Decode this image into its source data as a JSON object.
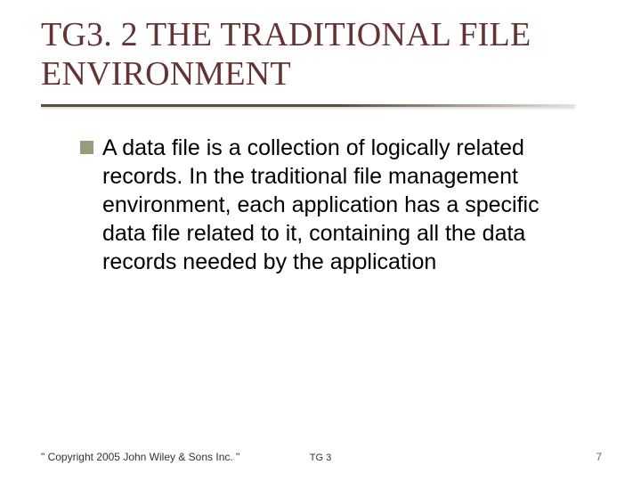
{
  "title": "TG3. 2 THE TRADITIONAL FILE ENVIRONMENT",
  "bullets": [
    "A data file is a collection of logically related records. In the traditional file management environment, each application has a specific data file related to it, containing all the data records needed by the application"
  ],
  "footer": {
    "left": "\" Copyright 2005 John Wiley & Sons Inc. \"",
    "center": "TG 3",
    "right": "7"
  }
}
